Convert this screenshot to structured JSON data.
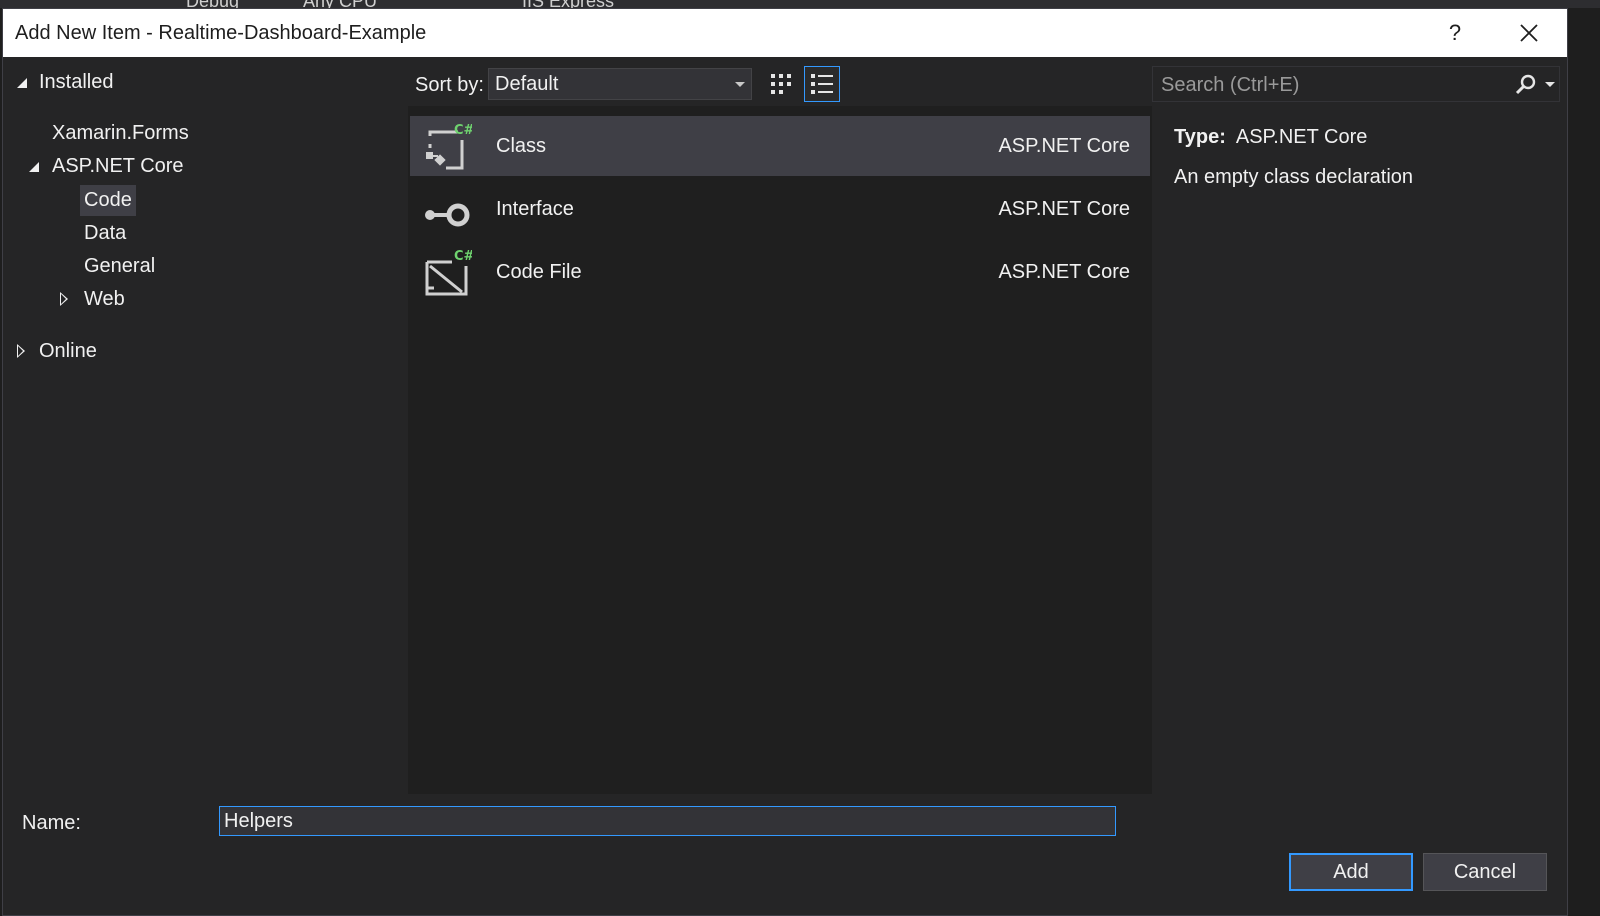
{
  "ide_background": {
    "items": [
      "Debug",
      "Any CPU",
      "IIS Express"
    ]
  },
  "dialog": {
    "title": "Add New Item - Realtime-Dashboard-Example",
    "help_label": "?",
    "close_label": "✕"
  },
  "tree": {
    "installed": "Installed",
    "xamarin": "Xamarin.Forms",
    "aspnet": "ASP.NET Core",
    "code": "Code",
    "data": "Data",
    "general": "General",
    "web": "Web",
    "online": "Online"
  },
  "toolbar": {
    "sort_label": "Sort by:",
    "sort_value": "Default",
    "grid_view_icon": "small-icons-view-icon",
    "list_view_icon": "list-view-icon"
  },
  "items": [
    {
      "name": "Class",
      "type": "ASP.NET Core",
      "icon": "csharp-class-icon"
    },
    {
      "name": "Interface",
      "type": "ASP.NET Core",
      "icon": "interface-icon"
    },
    {
      "name": "Code File",
      "type": "ASP.NET Core",
      "icon": "csharp-code-file-icon"
    }
  ],
  "search": {
    "placeholder": "Search (Ctrl+E)"
  },
  "details": {
    "type_label": "Type:",
    "type_value": "ASP.NET Core",
    "description": "An empty class declaration"
  },
  "footer": {
    "name_label": "Name:",
    "name_value": "Helpers",
    "add_label": "Add",
    "cancel_label": "Cancel"
  },
  "colors": {
    "accent": "#3399ff",
    "csharp_green": "#6fd36f",
    "dialog_bg": "#252526",
    "selected_bg": "#3f3f46"
  }
}
